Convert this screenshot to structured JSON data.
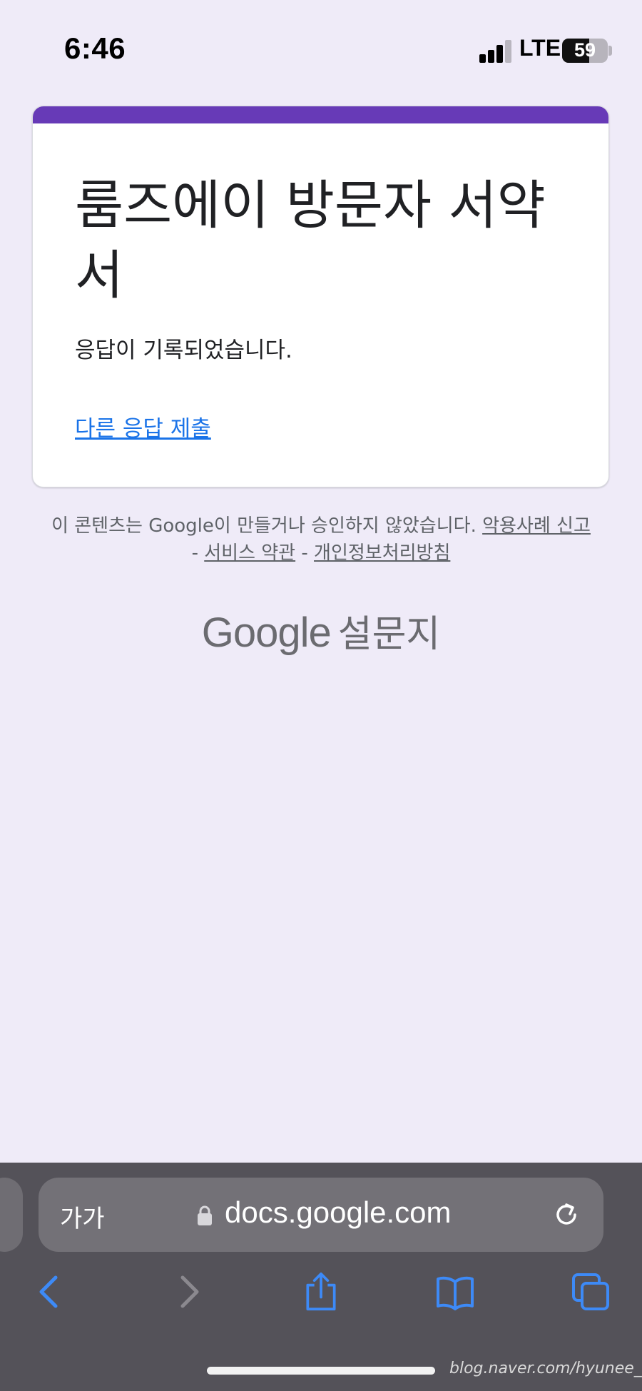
{
  "status_bar": {
    "time": "6:46",
    "network": "LTE",
    "battery_level": "59",
    "battery_fill_percent": 59
  },
  "form": {
    "accent_color": "#673ab7",
    "title": "룸즈에이 방문자 서약서",
    "confirmation": "응답이 기록되었습니다.",
    "resubmit_link": "다른 응답 제출"
  },
  "footer": {
    "disclaimer_text": "이 콘텐츠는 Google이 만들거나 승인하지 않았습니다.",
    "links": [
      "악용사례 신고",
      "서비스 약관",
      "개인정보처리방침"
    ],
    "separator": "-",
    "brand_google": "Google",
    "brand_forms": "설문지"
  },
  "browser": {
    "text_size_button": "가가",
    "url": "docs.google.com",
    "icons": [
      "lock-icon",
      "reload-icon",
      "back-icon",
      "forward-icon",
      "share-icon",
      "bookmarks-icon",
      "tabs-icon"
    ],
    "accent_color": "#3d8af7"
  },
  "watermark": "blog.naver.com/hyunee_o_o"
}
